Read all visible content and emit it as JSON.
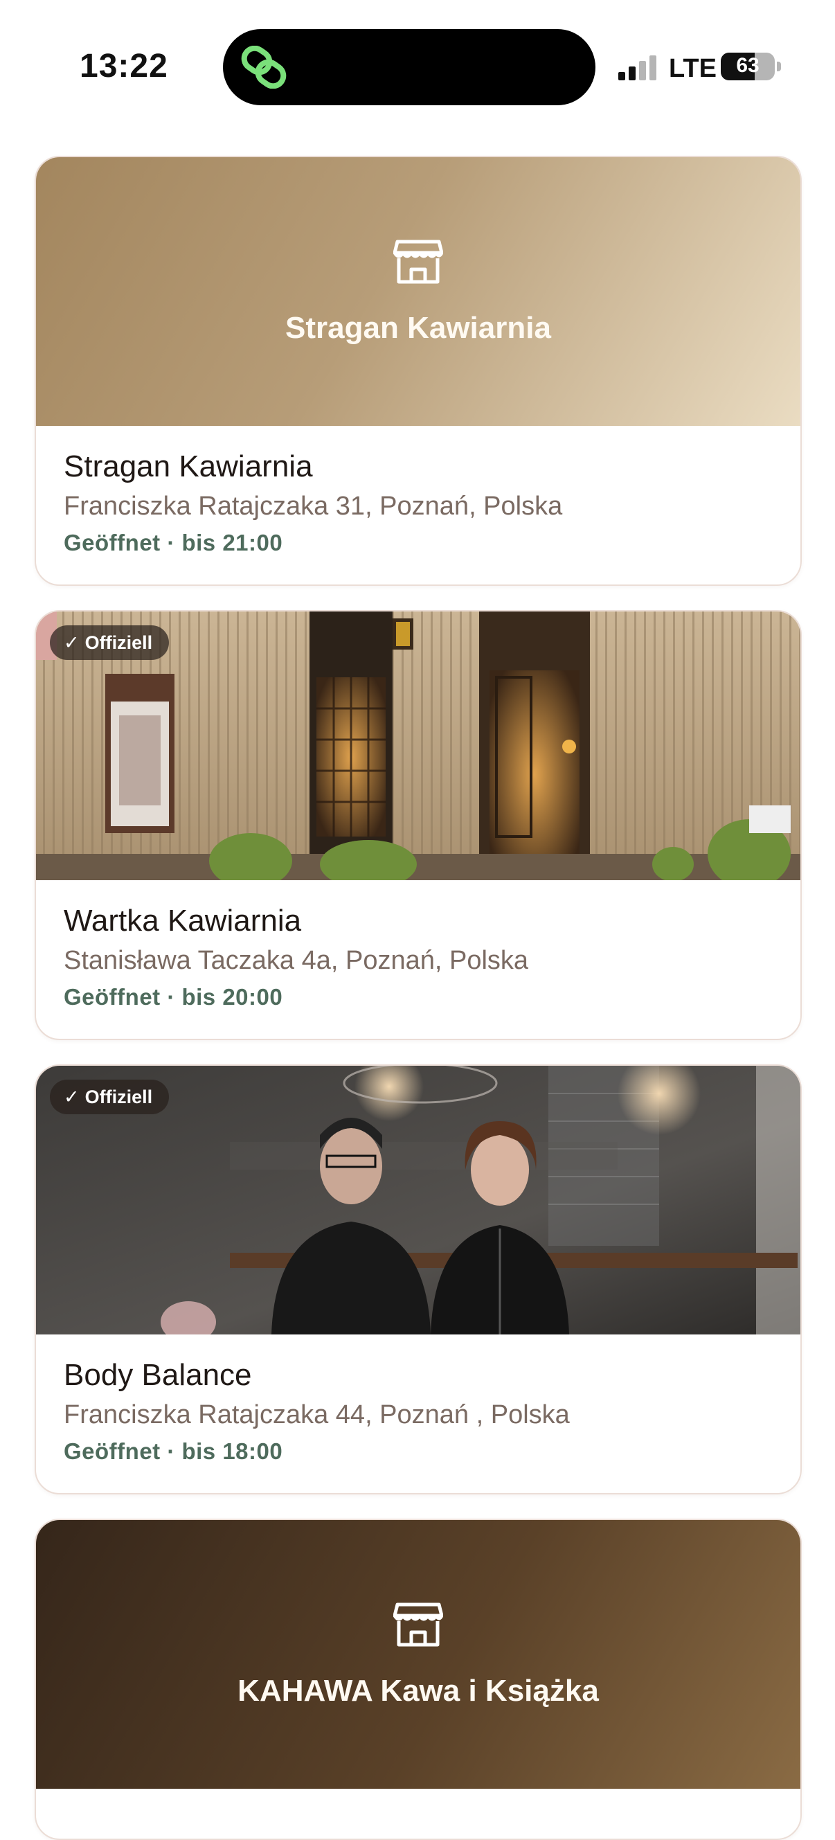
{
  "status_bar": {
    "time": "13:22",
    "carrier": "LTE",
    "battery_level": "63",
    "battery_fraction": 0.63,
    "signal_bars_active": 2,
    "signal_bars_total": 4
  },
  "colors": {
    "status_open": "#4e6b5c",
    "address": "#7a6a62",
    "card_border": "#ebddd6",
    "accent_green": "#7ae07a"
  },
  "cards": [
    {
      "hero_type": "placeholder",
      "hero_icon": "storefront-icon",
      "hero_title": "Stragan Kawiarnia",
      "name": "Stragan Kawiarnia",
      "address": "Franciszka Ratajczaka 31, Poznań, Polska",
      "status": "Geöffnet · bis 21:00"
    },
    {
      "hero_type": "photo",
      "badge": "Offiziell",
      "badge_icon": "checkmark-icon",
      "name": "Wartka Kawiarnia",
      "address": "Stanisława Taczaka 4a, Poznań, Polska",
      "status": "Geöffnet · bis 20:00"
    },
    {
      "hero_type": "photo",
      "badge": "Offiziell",
      "badge_icon": "checkmark-icon",
      "name": "Body Balance",
      "address": "Franciszka Ratajczaka 44, Poznań , Polska",
      "status": "Geöffnet · bis 18:00"
    },
    {
      "hero_type": "placeholder",
      "hero_icon": "storefront-icon",
      "hero_title": "KAHAWA Kawa i Książka"
    }
  ]
}
